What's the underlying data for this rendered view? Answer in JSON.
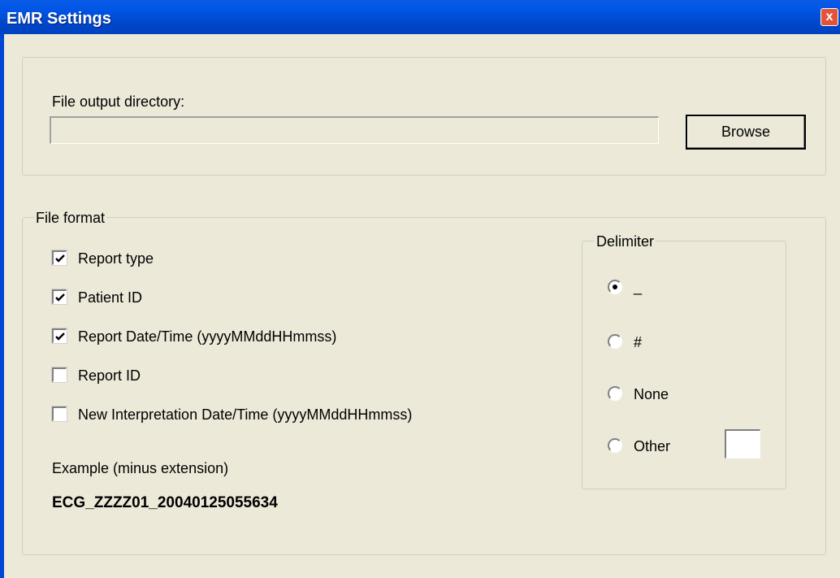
{
  "window": {
    "title": "EMR Settings",
    "close_glyph": "x",
    "close_icon": "close-icon"
  },
  "output": {
    "label": "File output directory:",
    "directory_value": "",
    "browse_label": "Browse"
  },
  "file_format": {
    "legend": "File format",
    "options": [
      {
        "label": "Report type",
        "checked": true
      },
      {
        "label": "Patient ID",
        "checked": true
      },
      {
        "label": "Report Date/Time (yyyyMMddHHmmss)",
        "checked": true
      },
      {
        "label": "Report ID",
        "checked": false
      },
      {
        "label": "New Interpretation Date/Time (yyyyMMddHHmmss)",
        "checked": false
      }
    ],
    "example_label": "Example (minus extension)",
    "example_value": "ECG_ZZZZ01_20040125055634"
  },
  "delimiter": {
    "legend": "Delimiter",
    "options": [
      {
        "label": "_",
        "selected": true
      },
      {
        "label": "#",
        "selected": false
      },
      {
        "label": "None",
        "selected": false
      },
      {
        "label": "Other",
        "selected": false
      }
    ],
    "other_value": ""
  }
}
